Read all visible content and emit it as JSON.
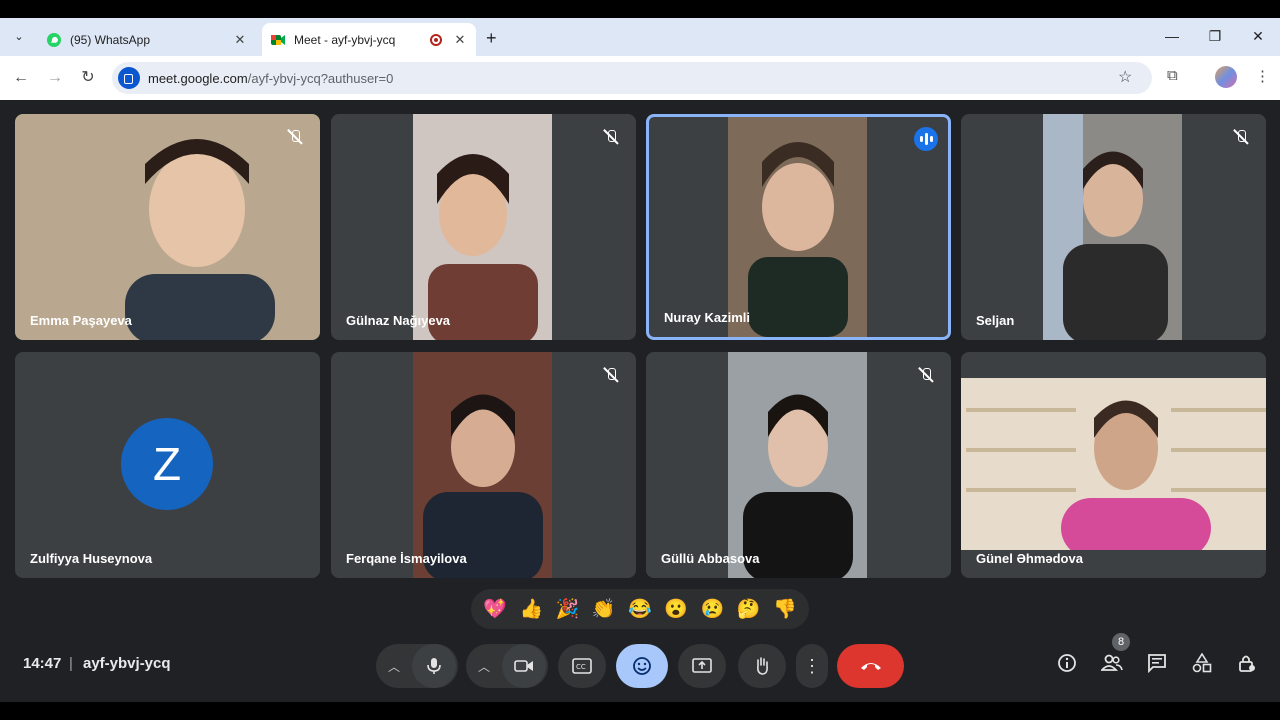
{
  "browser": {
    "tabs": [
      {
        "title": "(95) WhatsApp",
        "favicon": "whatsapp-icon",
        "active": false
      },
      {
        "title": "Meet - ayf-ybvj-ycq",
        "favicon": "google-meet-icon",
        "active": true,
        "recording": true
      }
    ],
    "url_host": "meet.google.com",
    "url_path": "/ayf-ybvj-ycq?authuser=0"
  },
  "participants": [
    {
      "name": "Emma Paşayeva",
      "muted": true,
      "bg": "#b9a88f"
    },
    {
      "name": "Gülnaz Nağıyeva",
      "muted": true,
      "bg": "#8c6f63"
    },
    {
      "name": "Nuray Kazimli",
      "muted": false,
      "speaking": true,
      "bg": "#7d6a58"
    },
    {
      "name": "Seljan",
      "muted": true,
      "bg": "#8b8a86"
    },
    {
      "name": "Zulfiyya Huseynova",
      "muted": false,
      "avatar_letter": "Z"
    },
    {
      "name": "Ferqane İsmayilova",
      "muted": true,
      "bg": "#6b3f34"
    },
    {
      "name": "Güllü Abbasova",
      "muted": true,
      "bg": "#9aa0a4"
    },
    {
      "name": "Günel Əhmədova",
      "muted": false,
      "bg": "#d9c9b0"
    }
  ],
  "reactions": [
    "💖",
    "👍",
    "🎉",
    "👏",
    "😂",
    "😮",
    "😢",
    "🤔",
    "👎"
  ],
  "footer": {
    "time": "14:47",
    "separator": "|",
    "meeting_code": "ayf-ybvj-ycq",
    "people_count": "8"
  },
  "colors": {
    "leave": "#dc362e",
    "emoji_active": "#a8c7fa",
    "tile": "#3c4043",
    "speaking_border": "#8ab4f8"
  }
}
